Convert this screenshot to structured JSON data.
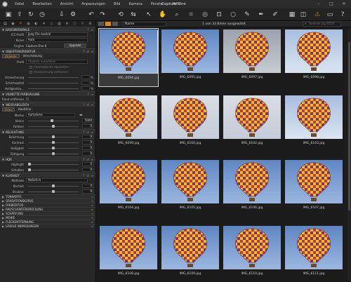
{
  "app": {
    "title": "Capture One"
  },
  "menu": [
    "Datei",
    "Bearbeiten",
    "Ansicht",
    "Anpassungen",
    "Bild",
    "Kamera",
    "Fenster",
    "Hilfe"
  ],
  "left_panel": {
    "basis": {
      "title": "BASISMERKMALE",
      "icc_label": "ICC-Profil",
      "icc_value": "Jpeg File neutral",
      "kurve_label": "Kurve",
      "kurve_value": "Auto",
      "engine_label": "Engine",
      "engine_value": "Capture One 8",
      "upgrade": "Upgrade"
    },
    "objektiv": {
      "title": "OBJEKTIVKORREKTUR",
      "tab1": "Objektiv",
      "tab2": "Verschiebung",
      "profil_label": "Profil",
      "profil_value": "Objektiv auswählen",
      "cb1": "Chromatische Aberration",
      "cb2": "Verzeichnung verfeinern",
      "verz_label": "Verzeichnung",
      "verz_unit": "%",
      "schaerf_label": "Schärfeabfall",
      "schaerf_unit": "%",
      "hell_label": "Helligkeitsa...",
      "hell_unit": "%"
    },
    "vignette": {
      "title": "VIGNETTE FARBSÄULINE",
      "label": "Rand entfernen"
    },
    "weissabgleich": {
      "title": "WEISSABGLEICH",
      "tab1": "Grau",
      "tab2": "Hauttöne",
      "modus_label": "Modus",
      "modus_value": "Aufnahme",
      "kelvin_label": "Kelvin",
      "kelvin_value": "5000",
      "farbton_label": "Farbton",
      "farbton_value": "0"
    },
    "belichtung": {
      "title": "BELICHTUNG",
      "rows": [
        {
          "label": "Belichtung",
          "value": "0"
        },
        {
          "label": "Kontrast",
          "value": "0"
        },
        {
          "label": "Helligkeit",
          "value": "0"
        },
        {
          "label": "Sättigung",
          "value": "0"
        }
      ]
    },
    "hdr": {
      "title": "HDR",
      "rows": [
        {
          "label": "Highlight",
          "value": "0"
        },
        {
          "label": "Schatten",
          "value": "0"
        }
      ]
    },
    "klarheit": {
      "title": "KLARHEIT",
      "methode_label": "Methode",
      "methode_value": "Natürlich",
      "rows": [
        {
          "label": "Klarheit",
          "value": "0"
        },
        {
          "label": "Struktur",
          "value": "0"
        }
      ]
    },
    "collapsed": [
      "TONWERTE",
      "GRADATIONSKURVE",
      "FARBEDITOR",
      "RAUSCHUNTERDRÜCKUNG",
      "SCHÄRFUNG",
      "MOIRÉ",
      "FLECKENTFERNUNG",
      "LOKALE ANPASSUNGEN"
    ]
  },
  "browser": {
    "sort_value": "Name",
    "count_label": "1 von 33 Bilder ausgewählt",
    "search_placeholder": "Suchen pg 6555",
    "thumbnails": [
      {
        "name": "IMG_6094.jpg",
        "sky": "sky-pale",
        "selected": true
      },
      {
        "name": "IMG_6095.jpg",
        "sky": "sky-pale",
        "selected": false
      },
      {
        "name": "IMG_6097.jpg",
        "sky": "sky-pale",
        "selected": false
      },
      {
        "name": "IMG_6098.jpg",
        "sky": "sky-pale",
        "selected": false
      },
      {
        "name": "IMG_6099.jpg",
        "sky": "sky-pale",
        "selected": false
      },
      {
        "name": "IMG_6100.jpg",
        "sky": "sky-pale",
        "selected": false
      },
      {
        "name": "IMG_6102.jpg",
        "sky": "sky-pale",
        "selected": false
      },
      {
        "name": "IMG_6103.jpg",
        "sky": "sky-light",
        "selected": false
      },
      {
        "name": "IMG_6104.jpg",
        "sky": "sky-blue",
        "selected": false
      },
      {
        "name": "IMG_6105.jpg",
        "sky": "sky-blue",
        "selected": false
      },
      {
        "name": "IMG_6106.jpg",
        "sky": "sky-blue",
        "selected": false
      },
      {
        "name": "IMG_6107.jpg",
        "sky": "sky-blue",
        "selected": false
      },
      {
        "name": "IMG_6108.jpg",
        "sky": "sky-blue",
        "selected": false
      },
      {
        "name": "IMG_6109.jpg",
        "sky": "sky-blue",
        "selected": false
      },
      {
        "name": "IMG_6110.jpg",
        "sky": "sky-blue",
        "selected": false
      },
      {
        "name": "IMG_6111.jpg",
        "sky": "sky-blue",
        "selected": false
      },
      {
        "name": "",
        "sky": "sky-blue",
        "selected": false
      },
      {
        "name": "",
        "sky": "sky-blue",
        "selected": false
      },
      {
        "name": "",
        "sky": "sky-grey",
        "selected": false
      },
      {
        "name": "",
        "sky": "sky-light",
        "selected": false
      }
    ]
  },
  "colors": {
    "accent": "#e8861e",
    "background": "#1e1e1e"
  }
}
